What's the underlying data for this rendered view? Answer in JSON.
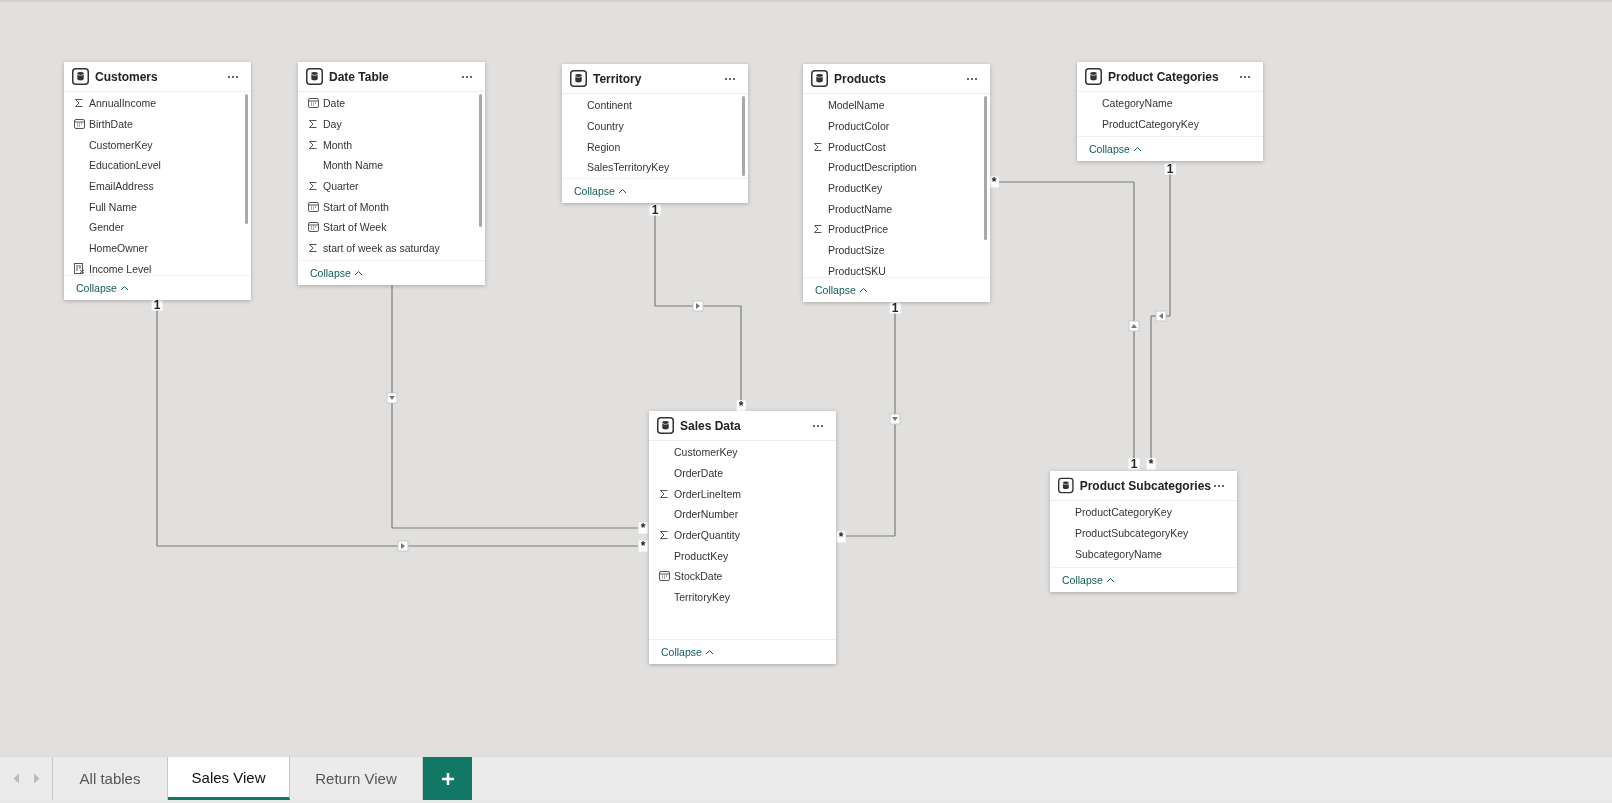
{
  "tables": [
    {
      "title": "Customers",
      "collapse_label": "Collapse",
      "fields": [
        {
          "name": "AnnualIncome",
          "kind": "sigma"
        },
        {
          "name": "BirthDate",
          "kind": "calendar"
        },
        {
          "name": "CustomerKey",
          "kind": "plain"
        },
        {
          "name": "EducationLevel",
          "kind": "plain"
        },
        {
          "name": "EmailAddress",
          "kind": "plain"
        },
        {
          "name": "Full Name",
          "kind": "plain"
        },
        {
          "name": "Gender",
          "kind": "plain"
        },
        {
          "name": "HomeOwner",
          "kind": "plain"
        },
        {
          "name": "Income Level",
          "kind": "calculated"
        }
      ]
    },
    {
      "title": "Date Table",
      "collapse_label": "Collapse",
      "fields": [
        {
          "name": "Date",
          "kind": "calendar"
        },
        {
          "name": "Day",
          "kind": "sigma"
        },
        {
          "name": "Month",
          "kind": "sigma"
        },
        {
          "name": "Month Name",
          "kind": "plain"
        },
        {
          "name": "Quarter",
          "kind": "sigma"
        },
        {
          "name": "Start of Month",
          "kind": "calendar"
        },
        {
          "name": "Start of Week",
          "kind": "calendar"
        },
        {
          "name": "start of week as saturday",
          "kind": "sigma"
        }
      ]
    },
    {
      "title": "Territory",
      "collapse_label": "Collapse",
      "fields": [
        {
          "name": "Continent",
          "kind": "plain"
        },
        {
          "name": "Country",
          "kind": "plain"
        },
        {
          "name": "Region",
          "kind": "plain"
        },
        {
          "name": "SalesTerritoryKey",
          "kind": "plain"
        }
      ]
    },
    {
      "title": "Products",
      "collapse_label": "Collapse",
      "fields": [
        {
          "name": "ModelName",
          "kind": "plain"
        },
        {
          "name": "ProductColor",
          "kind": "plain"
        },
        {
          "name": "ProductCost",
          "kind": "sigma"
        },
        {
          "name": "ProductDescription",
          "kind": "plain"
        },
        {
          "name": "ProductKey",
          "kind": "plain"
        },
        {
          "name": "ProductName",
          "kind": "plain"
        },
        {
          "name": "ProductPrice",
          "kind": "sigma"
        },
        {
          "name": "ProductSize",
          "kind": "plain"
        },
        {
          "name": "ProductSKU",
          "kind": "plain"
        }
      ]
    },
    {
      "title": "Product Categories",
      "collapse_label": "Collapse",
      "fields": [
        {
          "name": "CategoryName",
          "kind": "plain"
        },
        {
          "name": "ProductCategoryKey",
          "kind": "plain"
        }
      ]
    },
    {
      "title": "Sales Data",
      "collapse_label": "Collapse",
      "fields": [
        {
          "name": "CustomerKey",
          "kind": "plain"
        },
        {
          "name": "OrderDate",
          "kind": "plain"
        },
        {
          "name": "OrderLineItem",
          "kind": "sigma"
        },
        {
          "name": "OrderNumber",
          "kind": "plain"
        },
        {
          "name": "OrderQuantity",
          "kind": "sigma"
        },
        {
          "name": "ProductKey",
          "kind": "plain"
        },
        {
          "name": "StockDate",
          "kind": "calendar"
        },
        {
          "name": "TerritoryKey",
          "kind": "plain"
        }
      ]
    },
    {
      "title": "Product Subcategories",
      "collapse_label": "Collapse",
      "fields": [
        {
          "name": "ProductCategoryKey",
          "kind": "plain"
        },
        {
          "name": "ProductSubcategoryKey",
          "kind": "plain"
        },
        {
          "name": "SubcategoryName",
          "kind": "plain"
        }
      ]
    }
  ],
  "relationships": [
    {
      "from_label": "1",
      "to_label": "*"
    },
    {
      "to_label": "*"
    },
    {
      "from_label": "1",
      "to_label": "*"
    },
    {
      "from_label": "1",
      "to_label": "*"
    },
    {
      "from_label": "*",
      "to_label": "1"
    },
    {
      "from_label": "1",
      "to_label": "*"
    }
  ],
  "tabs": [
    {
      "label": "All tables",
      "selected": false
    },
    {
      "label": "Sales View",
      "selected": true
    },
    {
      "label": "Return View",
      "selected": false
    }
  ]
}
